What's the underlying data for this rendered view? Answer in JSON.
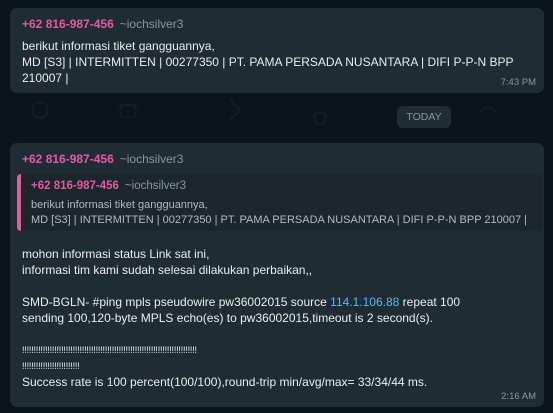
{
  "message1": {
    "sender_phone": "+62 816-987-456",
    "sender_alias": "~iochsilver3",
    "lines": [
      "berikut informasi tiket gangguannya,",
      "MD [S3] | INTERMITTEN | 00277350 | PT. PAMA PERSADA NUSANTARA | DIFI P-P-N BPP",
      "210007 |"
    ],
    "time": "7:43 PM"
  },
  "date_divider": "TODAY",
  "message2": {
    "sender_phone": "+62 816-987-456",
    "sender_alias": "~iochsilver3",
    "quote": {
      "sender_phone": "+62 816-987-456",
      "sender_alias": "~iochsilver3",
      "lines": [
        "berikut informasi tiket gangguannya,",
        "MD [S3] | INTERMITTEN | 00277350 | PT. PAMA PERSADA NUSANTARA | DIFI P-P-N BPP 210007 |"
      ]
    },
    "line1": "mohon informasi status Link sat ini,",
    "line2": "informasi tim kami sudah selesai dilakukan perbaikan,,",
    "ping_prefix": "SMD-BGLN- #ping mpls pseudowire pw36002015 source ",
    "ping_ip": "114.1.106.88",
    "ping_suffix": " repeat 100",
    "line4": "sending 100,120-byte MPLS echo(es) to pw36002015,timeout is 2 second(s).",
    "bang1": "!!!!!!!!!!!!!!!!!!!!!!!!!!!!!!!!!!!!!!!!!!!!!!!!!!!!!!!!!!!!!!!!!!!!!!!!!!!!",
    "bang2": "!!!!!!!!!!!!!!!!!!!!!!!!!",
    "line7": "Success rate is 100 percent(100/100),round-trip min/avg/max= 33/34/44 ms.",
    "time": "2:16 AM"
  }
}
